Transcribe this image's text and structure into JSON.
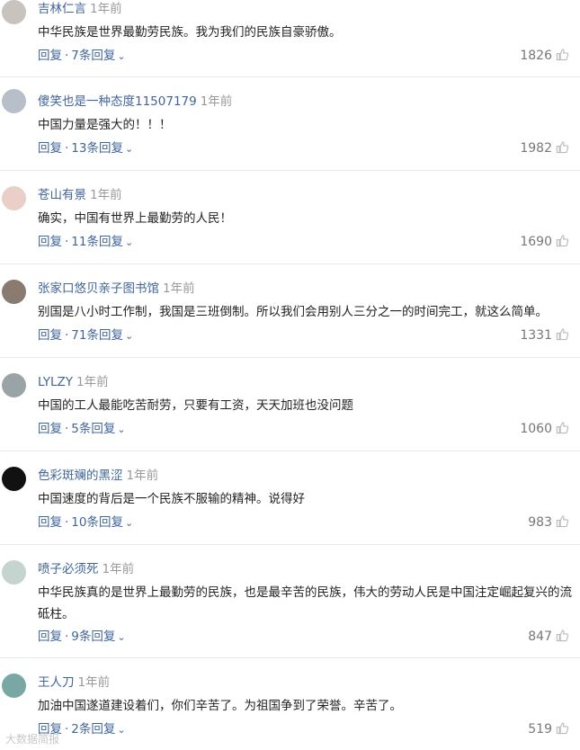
{
  "comments": [
    {
      "username": "吉林仁言",
      "time": "1年前",
      "content": "中华民族是世界最勤劳民族。我为我们的民族自豪骄傲。",
      "reply": "回复",
      "replies": "7条回复",
      "likes": "1826"
    },
    {
      "username": "傻笑也是一种态度11507179",
      "time": "1年前",
      "content": "中国力量是强大的！！！",
      "reply": "回复",
      "replies": "13条回复",
      "likes": "1982"
    },
    {
      "username": "苍山有景",
      "time": "1年前",
      "content": "确实，中国有世界上最勤劳的人民！",
      "reply": "回复",
      "replies": "11条回复",
      "likes": "1690"
    },
    {
      "username": "张家口悠贝亲子图书馆",
      "time": "1年前",
      "content": "别国是八小时工作制，我国是三班倒制。所以我们会用别人三分之一的时间完工，就这么简单。",
      "reply": "回复",
      "replies": "71条回复",
      "likes": "1331"
    },
    {
      "username": "LYLZY",
      "time": "1年前",
      "content": "中国的工人最能吃苦耐劳，只要有工资，天天加班也没问题",
      "reply": "回复",
      "replies": "5条回复",
      "likes": "1060"
    },
    {
      "username": "色彩斑斓的黑涩",
      "time": "1年前",
      "content": "中国速度的背后是一个民族不服输的精神。说得好",
      "reply": "回复",
      "replies": "10条回复",
      "likes": "983"
    },
    {
      "username": "喷子必须死",
      "time": "1年前",
      "content": "中华民族真的是世界上最勤劳的民族，也是最辛苦的民族，伟大的劳动人民是中国注定崛起复兴的流砥柱。",
      "reply": "回复",
      "replies": "9条回复",
      "likes": "847"
    },
    {
      "username": "王人刀",
      "time": "1年前",
      "content": "加油中国遂道建设着们，你们辛苦了。为祖国争到了荣誉。辛苦了。",
      "reply": "回复",
      "replies": "2条回复",
      "likes": "519"
    }
  ],
  "icons": {
    "like": "thumbs-up-icon",
    "expand": "chevron-down-icon"
  },
  "colors": {
    "link": "#406599",
    "time": "#999999",
    "likes": "#777777",
    "divider": "#e8e8e8"
  },
  "watermark": "大数据简报"
}
